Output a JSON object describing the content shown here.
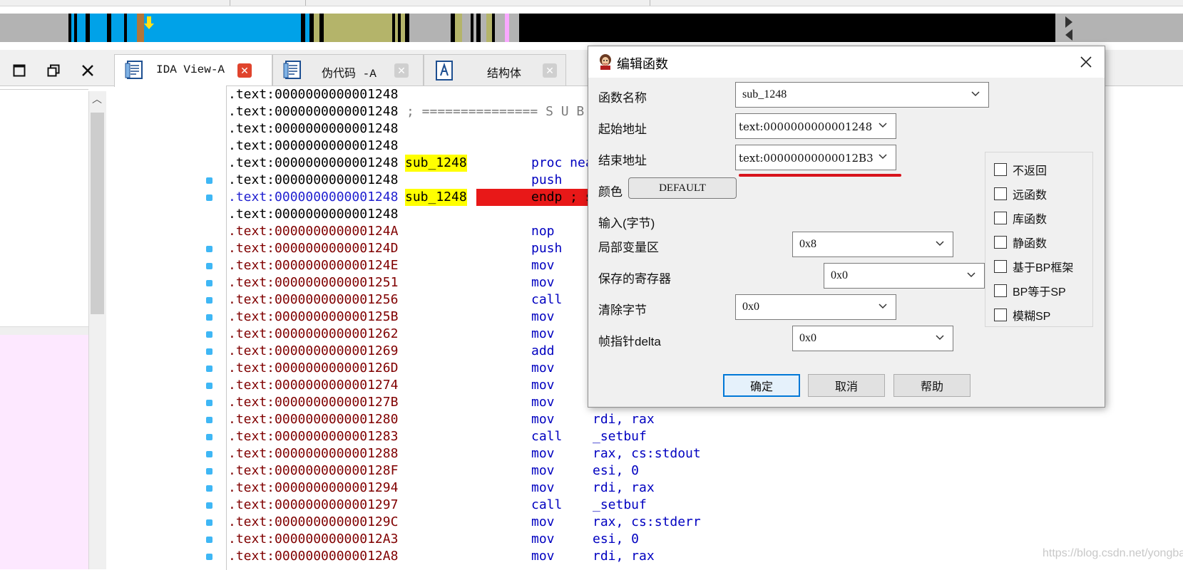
{
  "window_controls": {
    "maximize_icon": "maximize-icon",
    "restore_icon": "restore-icon",
    "close_icon": "close-icon"
  },
  "tabs": [
    {
      "label": "IDA View-A",
      "icon": "disassembly-view-icon",
      "close_color": "#e0442d"
    },
    {
      "label": "伪代码 -A",
      "icon": "pseudocode-view-icon",
      "close_color": "#c9c9c9"
    },
    {
      "label": "结构体",
      "icon": "structures-icon",
      "close_color": "#c9c9c9"
    }
  ],
  "disassembly": {
    "lines": [
      {
        "addr": ".text:0000000000001248",
        "label": "",
        "mnem": "",
        "ops": "",
        "color": "black"
      },
      {
        "addr": ".text:0000000000001248",
        "label": "; =============== S U B",
        "mnem": "",
        "ops": "",
        "color": "black"
      },
      {
        "addr": ".text:0000000000001248",
        "label": "",
        "mnem": "",
        "ops": "",
        "color": "black"
      },
      {
        "addr": ".text:0000000000001248",
        "label": "",
        "mnem": "",
        "ops": "",
        "color": "black"
      },
      {
        "addr": ".text:0000000000001248",
        "label": "sub_1248",
        "mnem": "proc nea",
        "ops": "",
        "color": "black"
      },
      {
        "addr": ".text:0000000000001248",
        "label": "",
        "mnem": "push",
        "ops": "",
        "color": "black"
      },
      {
        "addr": ".text:0000000000001248",
        "label": "sub_1248",
        "mnem": "endp ; s",
        "ops": "",
        "color": "blue"
      },
      {
        "addr": ".text:0000000000001248",
        "label": "",
        "mnem": "",
        "ops": "",
        "color": "black"
      },
      {
        "addr": ".text:000000000000124A",
        "label": "",
        "mnem": "nop",
        "ops": "",
        "color": "red"
      },
      {
        "addr": ".text:000000000000124D",
        "label": "",
        "mnem": "push",
        "ops": "",
        "color": "red"
      },
      {
        "addr": ".text:000000000000124E",
        "label": "",
        "mnem": "mov",
        "ops": "",
        "color": "red"
      },
      {
        "addr": ".text:0000000000001251",
        "label": "",
        "mnem": "mov",
        "ops": "",
        "color": "red"
      },
      {
        "addr": ".text:0000000000001256",
        "label": "",
        "mnem": "call",
        "ops": "",
        "color": "red"
      },
      {
        "addr": ".text:000000000000125B",
        "label": "",
        "mnem": "mov",
        "ops": "",
        "color": "red"
      },
      {
        "addr": ".text:0000000000001262",
        "label": "",
        "mnem": "mov",
        "ops": "",
        "color": "red"
      },
      {
        "addr": ".text:0000000000001269",
        "label": "",
        "mnem": "add",
        "ops": "",
        "color": "red"
      },
      {
        "addr": ".text:000000000000126D",
        "label": "",
        "mnem": "mov",
        "ops": "",
        "color": "red"
      },
      {
        "addr": ".text:0000000000001274",
        "label": "",
        "mnem": "mov",
        "ops": "",
        "color": "red"
      },
      {
        "addr": ".text:000000000000127B",
        "label": "",
        "mnem": "mov",
        "ops": "",
        "color": "red"
      },
      {
        "addr": ".text:0000000000001280",
        "label": "",
        "mnem": "mov",
        "ops": "rdi, rax",
        "color": "red"
      },
      {
        "addr": ".text:0000000000001283",
        "label": "",
        "mnem": "call",
        "ops": "_setbuf",
        "color": "red"
      },
      {
        "addr": ".text:0000000000001288",
        "label": "",
        "mnem": "mov",
        "ops": "rax, cs:stdout",
        "color": "red"
      },
      {
        "addr": ".text:000000000000128F",
        "label": "",
        "mnem": "mov",
        "ops": "esi, 0",
        "color": "red"
      },
      {
        "addr": ".text:0000000000001294",
        "label": "",
        "mnem": "mov",
        "ops": "rdi, rax",
        "color": "red"
      },
      {
        "addr": ".text:0000000000001297",
        "label": "",
        "mnem": "call",
        "ops": "_setbuf",
        "color": "red"
      },
      {
        "addr": ".text:000000000000129C",
        "label": "",
        "mnem": "mov",
        "ops": "rax, cs:stderr",
        "color": "red"
      },
      {
        "addr": ".text:00000000000012A3",
        "label": "",
        "mnem": "mov",
        "ops": "esi, 0",
        "color": "red"
      },
      {
        "addr": ".text:00000000000012A8",
        "label": "",
        "mnem": "mov",
        "ops": "rdi, rax",
        "color": "red"
      }
    ]
  },
  "dialog": {
    "title": "编辑函数",
    "close_icon": "close-icon",
    "func_name_label": "函数名称",
    "func_name": "sub_1248",
    "start_label": "起始地址",
    "start_value": "text:0000000000001248",
    "end_label": "结束地址",
    "end_value": "text:00000000000012B3",
    "color_label": "颜色",
    "color_value": "DEFAULT",
    "input_bytes_label": "输入(字节)",
    "local_vars_label": "局部变量区",
    "local_vars_value": "0x8",
    "saved_regs_label": "保存的寄存器",
    "saved_regs_value": "0x0",
    "purged_label": "清除字节",
    "purged_value": "0x0",
    "fpd_label": "帧指针delta",
    "fpd_value": "0x0",
    "checkboxes": [
      {
        "label": "不返回",
        "checked": false
      },
      {
        "label": "远函数",
        "checked": false
      },
      {
        "label": "库函数",
        "checked": false
      },
      {
        "label": "静函数",
        "checked": false
      },
      {
        "label": "基于BP框架",
        "checked": false
      },
      {
        "label": "BP等于SP",
        "checked": false
      },
      {
        "label": "模糊SP",
        "checked": false
      }
    ],
    "ok_label": "确定",
    "cancel_label": "取消",
    "help_label": "帮助"
  },
  "watermark": "https://blog.csdn.net/yongbaoii",
  "colors": {
    "label_highlight": "#ffff00",
    "endp_highlight": "#e81818",
    "address_red": "#800000",
    "address_blue": "#1f1fd0",
    "mnemonic_blue": "#0000c0",
    "nav_blue": "#00a2e8",
    "nav_olive": "#b4b46a",
    "nav_grey": "#b3b3b3",
    "nav_black": "#000000"
  }
}
